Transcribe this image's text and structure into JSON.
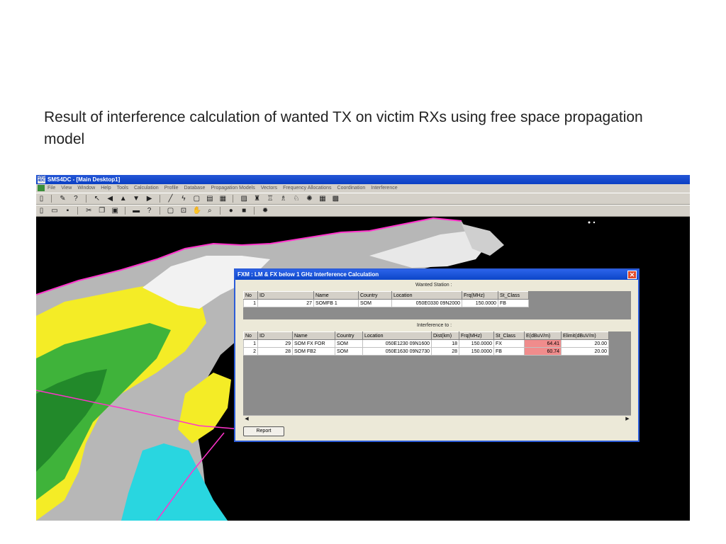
{
  "caption": "Result of interference calculation of wanted TX on victim RXs using free space propagation model",
  "app": {
    "title": "SMS4DC - [Main Desktop1]",
    "menu": [
      "File",
      "View",
      "Window",
      "Help",
      "Tools",
      "Calculation",
      "Profile",
      "Database",
      "Propagation Models",
      "Vectors",
      "Frequency Allocations",
      "Coordination",
      "Interference"
    ]
  },
  "dialog": {
    "title": "FXM : LM & FX below 1 GHz Interference Calculation",
    "close_label": "✕",
    "wanted_label": "Wanted Station :",
    "wanted_columns": [
      "No",
      "ID",
      "Name",
      "Country",
      "Location",
      "Frq(MHz)",
      "St_Class"
    ],
    "wanted_rows": [
      {
        "no": "1",
        "id": "27",
        "name": "SOMFB 1",
        "country": "SOM",
        "location": "050E0330  09N2000",
        "frq": "150.0000",
        "st_class": "FB"
      }
    ],
    "interf_label": "Interference to :",
    "interf_columns": [
      "No",
      "ID",
      "Name",
      "Country",
      "Location",
      "Dist(km)",
      "Frq(MHz)",
      "St_Class",
      "E(dBuV/m)",
      "Elimit(dBuV/m)"
    ],
    "interf_rows": [
      {
        "no": "1",
        "id": "29",
        "name": "SOM FX FOR",
        "country": "SOM",
        "location": "050E1230  09N1600",
        "dist": "18",
        "frq": "150.0000",
        "st_class": "FX",
        "e": "64.41",
        "elimit": "20.00"
      },
      {
        "no": "2",
        "id": "28",
        "name": "SOM FB2",
        "country": "SOM",
        "location": "050E1630  09N2730",
        "dist": "28",
        "frq": "150.0000",
        "st_class": "FB",
        "e": "60.74",
        "elimit": "20.00"
      }
    ],
    "report_label": "Report",
    "highlight_color": "#f08c8c"
  }
}
